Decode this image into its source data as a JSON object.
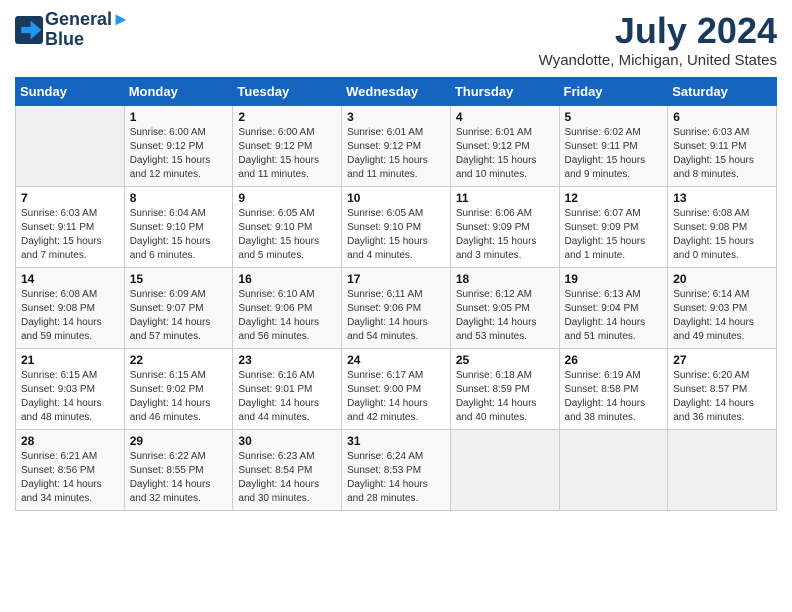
{
  "header": {
    "logo_line1": "General",
    "logo_line2": "Blue",
    "month_year": "July 2024",
    "location": "Wyandotte, Michigan, United States"
  },
  "days_of_week": [
    "Sunday",
    "Monday",
    "Tuesday",
    "Wednesday",
    "Thursday",
    "Friday",
    "Saturday"
  ],
  "weeks": [
    [
      {
        "day": "",
        "info": ""
      },
      {
        "day": "1",
        "info": "Sunrise: 6:00 AM\nSunset: 9:12 PM\nDaylight: 15 hours\nand 12 minutes."
      },
      {
        "day": "2",
        "info": "Sunrise: 6:00 AM\nSunset: 9:12 PM\nDaylight: 15 hours\nand 11 minutes."
      },
      {
        "day": "3",
        "info": "Sunrise: 6:01 AM\nSunset: 9:12 PM\nDaylight: 15 hours\nand 11 minutes."
      },
      {
        "day": "4",
        "info": "Sunrise: 6:01 AM\nSunset: 9:12 PM\nDaylight: 15 hours\nand 10 minutes."
      },
      {
        "day": "5",
        "info": "Sunrise: 6:02 AM\nSunset: 9:11 PM\nDaylight: 15 hours\nand 9 minutes."
      },
      {
        "day": "6",
        "info": "Sunrise: 6:03 AM\nSunset: 9:11 PM\nDaylight: 15 hours\nand 8 minutes."
      }
    ],
    [
      {
        "day": "7",
        "info": "Sunrise: 6:03 AM\nSunset: 9:11 PM\nDaylight: 15 hours\nand 7 minutes."
      },
      {
        "day": "8",
        "info": "Sunrise: 6:04 AM\nSunset: 9:10 PM\nDaylight: 15 hours\nand 6 minutes."
      },
      {
        "day": "9",
        "info": "Sunrise: 6:05 AM\nSunset: 9:10 PM\nDaylight: 15 hours\nand 5 minutes."
      },
      {
        "day": "10",
        "info": "Sunrise: 6:05 AM\nSunset: 9:10 PM\nDaylight: 15 hours\nand 4 minutes."
      },
      {
        "day": "11",
        "info": "Sunrise: 6:06 AM\nSunset: 9:09 PM\nDaylight: 15 hours\nand 3 minutes."
      },
      {
        "day": "12",
        "info": "Sunrise: 6:07 AM\nSunset: 9:09 PM\nDaylight: 15 hours\nand 1 minute."
      },
      {
        "day": "13",
        "info": "Sunrise: 6:08 AM\nSunset: 9:08 PM\nDaylight: 15 hours\nand 0 minutes."
      }
    ],
    [
      {
        "day": "14",
        "info": "Sunrise: 6:08 AM\nSunset: 9:08 PM\nDaylight: 14 hours\nand 59 minutes."
      },
      {
        "day": "15",
        "info": "Sunrise: 6:09 AM\nSunset: 9:07 PM\nDaylight: 14 hours\nand 57 minutes."
      },
      {
        "day": "16",
        "info": "Sunrise: 6:10 AM\nSunset: 9:06 PM\nDaylight: 14 hours\nand 56 minutes."
      },
      {
        "day": "17",
        "info": "Sunrise: 6:11 AM\nSunset: 9:06 PM\nDaylight: 14 hours\nand 54 minutes."
      },
      {
        "day": "18",
        "info": "Sunrise: 6:12 AM\nSunset: 9:05 PM\nDaylight: 14 hours\nand 53 minutes."
      },
      {
        "day": "19",
        "info": "Sunrise: 6:13 AM\nSunset: 9:04 PM\nDaylight: 14 hours\nand 51 minutes."
      },
      {
        "day": "20",
        "info": "Sunrise: 6:14 AM\nSunset: 9:03 PM\nDaylight: 14 hours\nand 49 minutes."
      }
    ],
    [
      {
        "day": "21",
        "info": "Sunrise: 6:15 AM\nSunset: 9:03 PM\nDaylight: 14 hours\nand 48 minutes."
      },
      {
        "day": "22",
        "info": "Sunrise: 6:15 AM\nSunset: 9:02 PM\nDaylight: 14 hours\nand 46 minutes."
      },
      {
        "day": "23",
        "info": "Sunrise: 6:16 AM\nSunset: 9:01 PM\nDaylight: 14 hours\nand 44 minutes."
      },
      {
        "day": "24",
        "info": "Sunrise: 6:17 AM\nSunset: 9:00 PM\nDaylight: 14 hours\nand 42 minutes."
      },
      {
        "day": "25",
        "info": "Sunrise: 6:18 AM\nSunset: 8:59 PM\nDaylight: 14 hours\nand 40 minutes."
      },
      {
        "day": "26",
        "info": "Sunrise: 6:19 AM\nSunset: 8:58 PM\nDaylight: 14 hours\nand 38 minutes."
      },
      {
        "day": "27",
        "info": "Sunrise: 6:20 AM\nSunset: 8:57 PM\nDaylight: 14 hours\nand 36 minutes."
      }
    ],
    [
      {
        "day": "28",
        "info": "Sunrise: 6:21 AM\nSunset: 8:56 PM\nDaylight: 14 hours\nand 34 minutes."
      },
      {
        "day": "29",
        "info": "Sunrise: 6:22 AM\nSunset: 8:55 PM\nDaylight: 14 hours\nand 32 minutes."
      },
      {
        "day": "30",
        "info": "Sunrise: 6:23 AM\nSunset: 8:54 PM\nDaylight: 14 hours\nand 30 minutes."
      },
      {
        "day": "31",
        "info": "Sunrise: 6:24 AM\nSunset: 8:53 PM\nDaylight: 14 hours\nand 28 minutes."
      },
      {
        "day": "",
        "info": ""
      },
      {
        "day": "",
        "info": ""
      },
      {
        "day": "",
        "info": ""
      }
    ]
  ]
}
